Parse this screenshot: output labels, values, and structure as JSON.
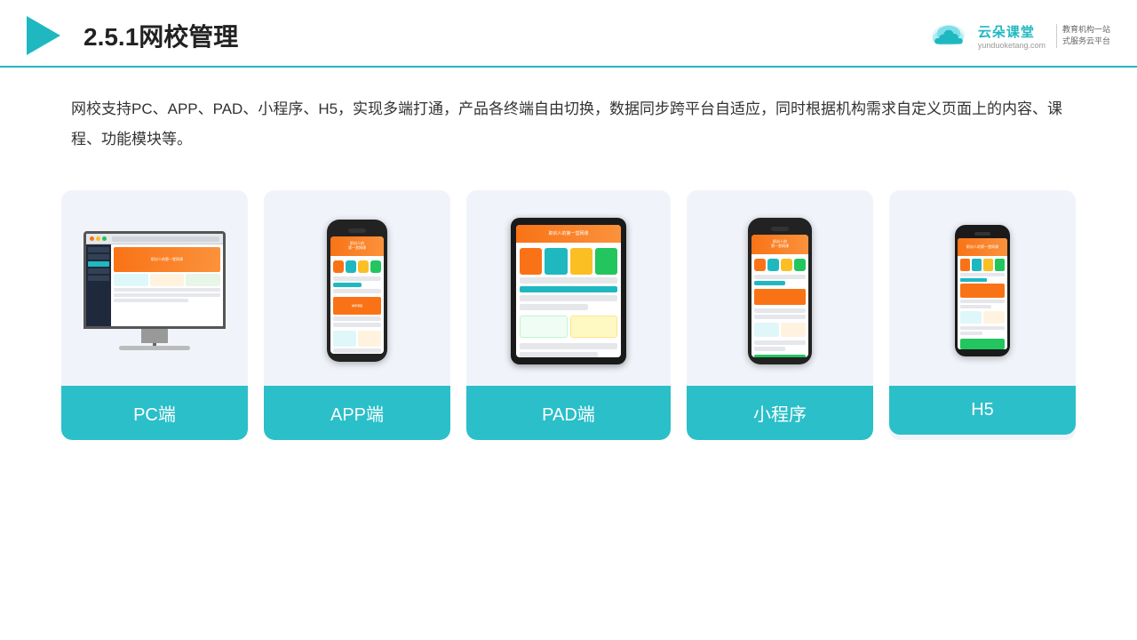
{
  "header": {
    "title": "2.5.1网校管理",
    "logo": {
      "name": "云朵课堂",
      "domain": "yunduoketang.com",
      "slogan": "教育机构一站\n式服务云平台"
    }
  },
  "description": {
    "text": "网校支持PC、APP、PAD、小程序、H5，实现多端打通，产品各终端自由切换，数据同步跨平台自适应，同时根据机构需求自定义页面上的内容、课程、功能模块等。"
  },
  "cards": [
    {
      "id": "pc",
      "label": "PC端"
    },
    {
      "id": "app",
      "label": "APP端"
    },
    {
      "id": "pad",
      "label": "PAD端"
    },
    {
      "id": "miniprogram",
      "label": "小程序"
    },
    {
      "id": "h5",
      "label": "H5"
    }
  ],
  "colors": {
    "teal": "#2bbfc9",
    "orange": "#f97316",
    "accent_line": "#1fb8c1"
  }
}
